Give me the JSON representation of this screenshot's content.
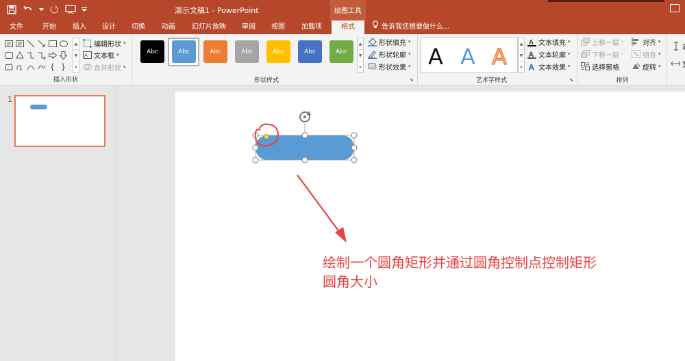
{
  "titlebar": {
    "title": "演示文稿1 - PowerPoint",
    "context_tools": "绘图工具",
    "save_icon": "save-icon",
    "undo_icon": "undo-icon",
    "redo_icon": "redo-icon",
    "present_icon": "present-icon",
    "customize_icon": "customize-qat-icon"
  },
  "tabs": [
    {
      "label": "文件"
    },
    {
      "label": "开始"
    },
    {
      "label": "插入"
    },
    {
      "label": "设计"
    },
    {
      "label": "切换"
    },
    {
      "label": "动画"
    },
    {
      "label": "幻灯片放映"
    },
    {
      "label": "审阅"
    },
    {
      "label": "视图"
    },
    {
      "label": "加载项"
    },
    {
      "label": "格式"
    }
  ],
  "tell_me": "告诉我您想要做什么...",
  "ribbon": {
    "insert_shapes": {
      "label": "插入形状",
      "edit_shape": "编辑形状",
      "text_box": "文本框",
      "merge_shapes": "合并形状"
    },
    "shape_styles": {
      "label": "形状样式",
      "presets": [
        {
          "text": "Abc",
          "color": "#000000"
        },
        {
          "text": "Abc",
          "color": "#5b9bd5"
        },
        {
          "text": "Abc",
          "color": "#ed7d31"
        },
        {
          "text": "Abc",
          "color": "#a5a5a5"
        },
        {
          "text": "Abc",
          "color": "#ffc000"
        },
        {
          "text": "Abc",
          "color": "#4472c4"
        },
        {
          "text": "Abc",
          "color": "#70ad47"
        }
      ],
      "fill": "形状填充",
      "outline": "形状轮廓",
      "effects": "形状效果"
    },
    "wordart": {
      "label": "艺术字样式",
      "letters": [
        "A",
        "A",
        "A"
      ],
      "text_fill": "文本填充",
      "text_outline": "文本轮廓",
      "text_effects": "文本效果"
    },
    "arrange": {
      "label": "排列",
      "bring_forward": "上移一层",
      "send_backward": "下移一层",
      "selection_pane": "选择窗格",
      "align": "对齐",
      "group": "组合",
      "rotate": "旋转"
    },
    "size": {
      "height_partial": "高",
      "width_partial": "宽"
    }
  },
  "thumbnails": [
    {
      "number": "1"
    }
  ],
  "annotation": {
    "line1": "绘制一个圆角矩形并通过圆角控制点控制矩形",
    "line2": "圆角大小"
  },
  "colors": {
    "accent": "#b7472a",
    "shape_fill": "#5b9bd5",
    "annotation_red": "#e8413f",
    "handle_yellow": "#f5d24a"
  }
}
